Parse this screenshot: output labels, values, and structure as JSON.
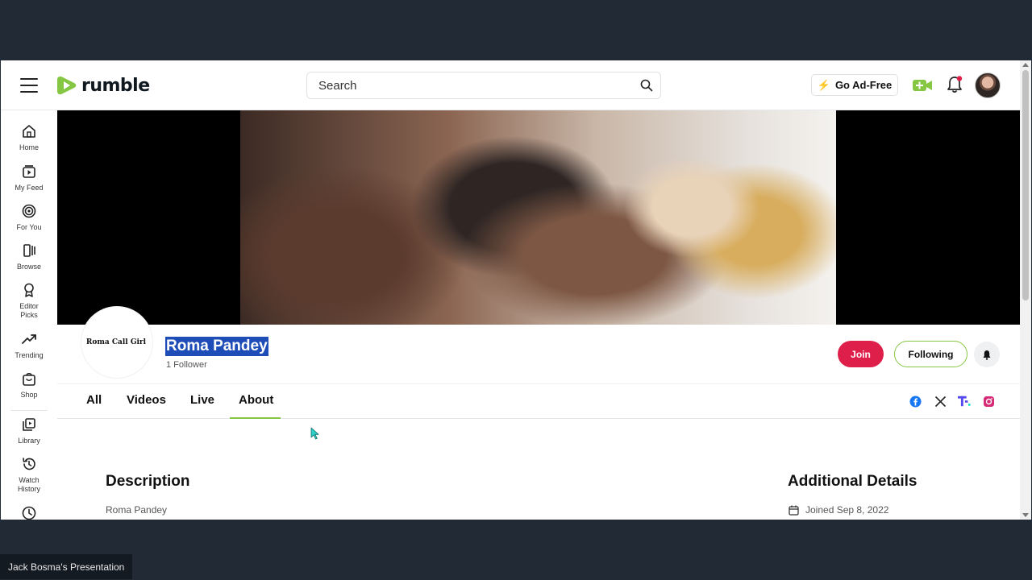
{
  "header": {
    "logo_text": "rumble",
    "search_placeholder": "Search",
    "ad_free_label": "Go Ad-Free"
  },
  "sidebar": {
    "items": [
      {
        "label": "Home",
        "icon": "home-icon"
      },
      {
        "label": "My Feed",
        "icon": "feed-icon"
      },
      {
        "label": "For You",
        "icon": "target-icon"
      },
      {
        "label": "Browse",
        "icon": "browse-icon"
      },
      {
        "label": "Editor Picks",
        "icon": "award-icon"
      },
      {
        "label": "Trending",
        "icon": "trending-icon"
      },
      {
        "label": "Shop",
        "icon": "shop-icon"
      },
      {
        "label": "Library",
        "icon": "library-icon"
      },
      {
        "label": "Watch History",
        "icon": "history-icon"
      }
    ]
  },
  "channel": {
    "avatar_text": "Roma Call Girl",
    "name": "Roma Pandey",
    "followers": "1 Follower",
    "join_label": "Join",
    "following_label": "Following"
  },
  "tabs": [
    {
      "label": "All"
    },
    {
      "label": "Videos"
    },
    {
      "label": "Live"
    },
    {
      "label": "About",
      "active": true
    }
  ],
  "social_icons": [
    "facebook-icon",
    "x-icon",
    "truth-social-icon",
    "instagram-icon"
  ],
  "about": {
    "description_title": "Description",
    "description_text": "Roma Pandey",
    "details_title": "Additional Details",
    "joined": "Joined Sep 8, 2022"
  },
  "presenter_label": "Jack Bosma's Presentation",
  "colors": {
    "brand_green": "#85c742",
    "join_red": "#dd1f4a",
    "selection_blue": "#1f4db8"
  }
}
